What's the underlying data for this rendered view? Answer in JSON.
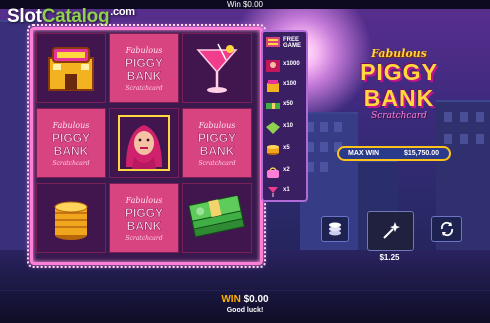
{
  "header": {
    "win_text": "Win $0.00"
  },
  "watermark": {
    "part1": "Slot",
    "part2": "Catalog",
    "part3": ".com"
  },
  "grid": {
    "cells": [
      {
        "symbol": "casino-building"
      },
      {
        "symbol": "piggy-bank-logo",
        "text": [
          "Fabulous",
          "PIGGY",
          "BANK",
          "Scratchcard"
        ]
      },
      {
        "symbol": "cocktail-glass"
      },
      {
        "symbol": "piggy-bank-logo",
        "text": [
          "Fabulous",
          "PIGGY",
          "BANK",
          "Scratchcard"
        ]
      },
      {
        "symbol": "glamour-lady"
      },
      {
        "symbol": "piggy-bank-logo",
        "text": [
          "Fabulous",
          "PIGGY",
          "BANK",
          "Scratchcard"
        ]
      },
      {
        "symbol": "gold-coins"
      },
      {
        "symbol": "piggy-bank-logo",
        "text": [
          "Fabulous",
          "PIGGY",
          "BANK",
          "Scratchcard"
        ]
      },
      {
        "symbol": "cash-stack"
      }
    ]
  },
  "paytable": [
    {
      "icon": "piggy-bank-logo",
      "label": "FREE\nGAME"
    },
    {
      "icon": "lady",
      "label": "x1000"
    },
    {
      "icon": "casino",
      "label": "x100"
    },
    {
      "icon": "cash",
      "label": "x50"
    },
    {
      "icon": "diamond",
      "label": "x10"
    },
    {
      "icon": "coins",
      "label": "x5"
    },
    {
      "icon": "purse",
      "label": "x2"
    },
    {
      "icon": "cocktail",
      "label": "x1"
    }
  ],
  "logo": {
    "line1": "Fabulous",
    "line2": "PIGGY",
    "line3": "BANK",
    "line4": "Scratchcard"
  },
  "max_win": {
    "label": "MAX WIN",
    "value": "$15,750.00"
  },
  "controls": {
    "bet": "$1.25"
  },
  "footer": {
    "win_label": "WIN",
    "win_value": "$0.00",
    "message": "Good luck!"
  },
  "colors": {
    "accent_pink": "#ff7fd8",
    "gold": "#ffd83f",
    "win_orange": "#ffb000"
  }
}
